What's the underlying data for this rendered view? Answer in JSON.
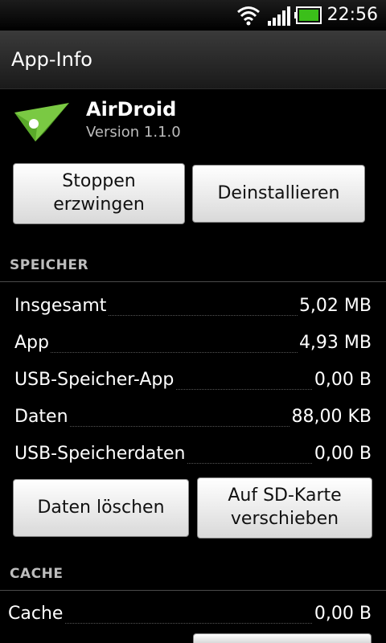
{
  "status_bar": {
    "time": "22:56",
    "icons": [
      "wifi-icon",
      "signal-icon",
      "battery-icon"
    ],
    "battery_color": "#3bbf1a"
  },
  "title_bar": {
    "title": "App-Info"
  },
  "app": {
    "name": "AirDroid",
    "version": "Version 1.1.0",
    "icon": "airdroid-logo-icon",
    "icon_colors": {
      "green": "#7ac943",
      "dark_green": "#3f8a18"
    }
  },
  "actions": {
    "force_stop": "Stoppen erzwingen",
    "uninstall": "Deinstallieren"
  },
  "storage": {
    "header": "SPEICHER",
    "rows": [
      {
        "label": "Insgesamt",
        "value": "5,02 MB"
      },
      {
        "label": "App",
        "value": "4,93 MB"
      },
      {
        "label": "USB-Speicher-App",
        "value": "0,00 B"
      },
      {
        "label": "Daten",
        "value": "88,00 KB"
      },
      {
        "label": "USB-Speicherdaten",
        "value": "0,00 B"
      }
    ],
    "clear_data": "Daten löschen",
    "move_to_sd": "Auf SD-Karte verschieben"
  },
  "cache": {
    "header": "CACHE",
    "rows": [
      {
        "label": "Cache",
        "value": "0,00 B"
      }
    ]
  }
}
